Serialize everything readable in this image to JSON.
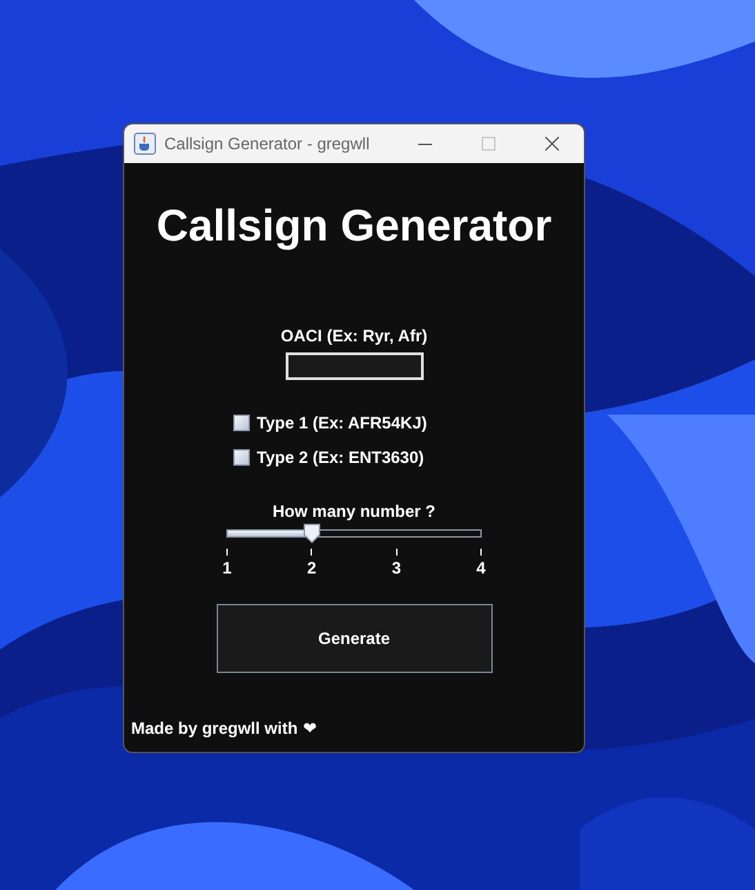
{
  "window": {
    "title": "Callsign Generator - gregwll"
  },
  "heading": "Callsign Generator",
  "oaci": {
    "label": "OACI (Ex: Ryr, Afr)"
  },
  "options": [
    {
      "label": "Type 1 (Ex: AFR54KJ)",
      "checked": false
    },
    {
      "label": "Type 2 (Ex: ENT3630)",
      "checked": false
    }
  ],
  "slider": {
    "label": "How many number ?",
    "level": 0.333,
    "ticks": [
      "1",
      "2",
      "3",
      "4"
    ]
  },
  "generate_button": "Generate",
  "footer": {
    "text": "Made by gregwll with",
    "symbol": "❤"
  }
}
